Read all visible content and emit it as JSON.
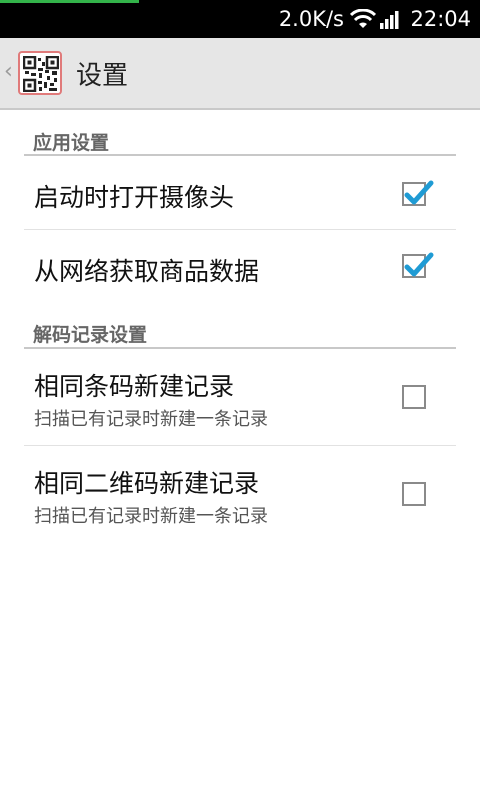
{
  "status_bar": {
    "net_speed": "2.0K/s",
    "time": "22:04",
    "icons": [
      "wifi-icon",
      "signal-icon"
    ],
    "download_progress": 0.29,
    "accent_color": "#33b34a"
  },
  "action_bar": {
    "title": "设置",
    "icons": [
      "back-chevron-icon",
      "qr-code-app-icon"
    ]
  },
  "sections": [
    {
      "header": "应用设置",
      "items": [
        {
          "title": "启动时打开摄像头",
          "checked": true
        },
        {
          "title": "从网络获取商品数据",
          "checked": true
        }
      ]
    },
    {
      "header": "解码记录设置",
      "items": [
        {
          "title": "相同条码新建记录",
          "summary": "扫描已有记录时新建一条记录",
          "checked": false
        },
        {
          "title": "相同二维码新建记录",
          "summary": "扫描已有记录时新建一条记录",
          "checked": false
        }
      ]
    }
  ],
  "colors": {
    "checkmark": "#1f9bd4",
    "section_header": "#666666"
  }
}
